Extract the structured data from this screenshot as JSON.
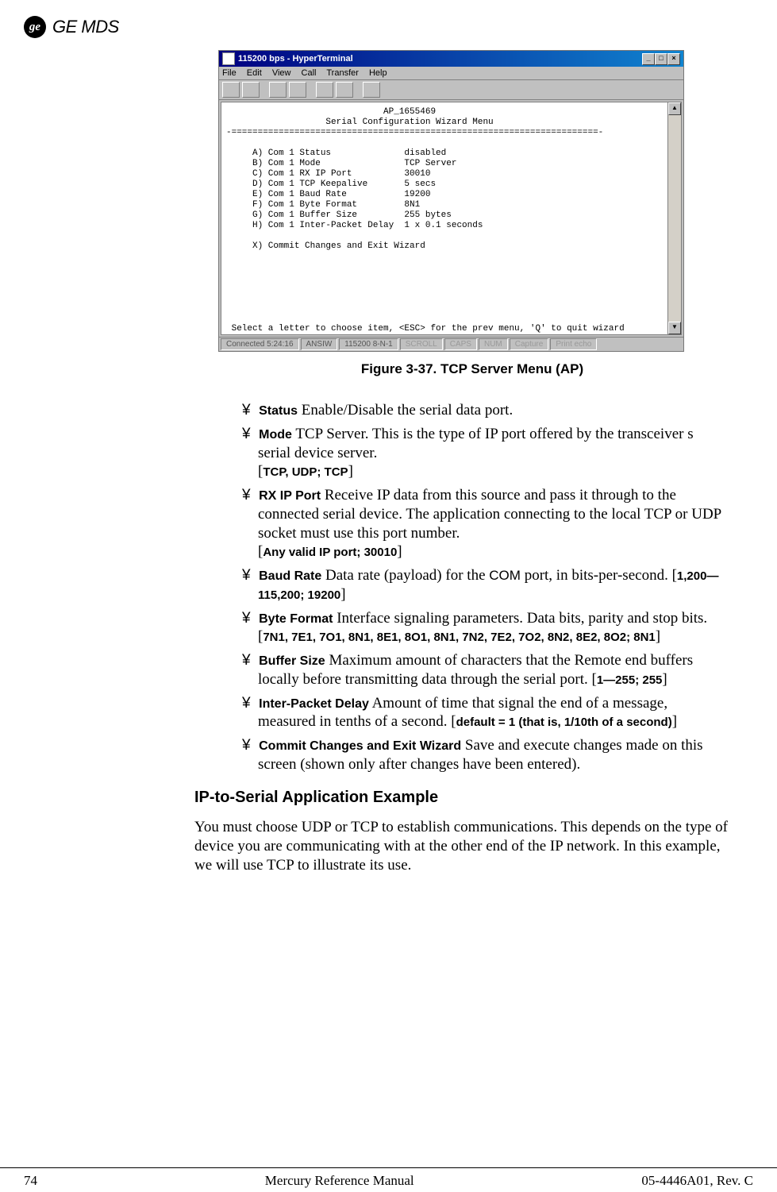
{
  "brand": {
    "logo_text": "ge",
    "name": "GE MDS"
  },
  "screenshot": {
    "title": "115200 bps - HyperTerminal",
    "menubar": [
      "File",
      "Edit",
      "View",
      "Call",
      "Transfer",
      "Help"
    ],
    "terminal_text": "                              AP_1655469\n                   Serial Configuration Wizard Menu\n-======================================================================-\n\n     A) Com 1 Status              disabled\n     B) Com 1 Mode                TCP Server\n     C) Com 1 RX IP Port          30010\n     D) Com 1 TCP Keepalive       5 secs\n     E) Com 1 Baud Rate           19200\n     F) Com 1 Byte Format         8N1\n     G) Com 1 Buffer Size         255 bytes\n     H) Com 1 Inter-Packet Delay  1 x 0.1 seconds\n\n     X) Commit Changes and Exit Wizard\n\n\n\n\n\n\n\n Select a letter to choose item, <ESC> for the prev menu, 'Q' to quit wizard",
    "status": {
      "connected": "Connected 5:24:16",
      "emulation": "ANSIW",
      "settings": "115200 8-N-1",
      "scroll": "SCROLL",
      "caps": "CAPS",
      "num": "NUM",
      "capture": "Capture",
      "echo": "Print echo"
    }
  },
  "figure_caption": "Figure 3-37. TCP Server Menu (AP)",
  "params": [
    {
      "name": "Status",
      "desc": "Enable/Disable the serial data port."
    },
    {
      "name": "Mode",
      "desc": "TCP Server. This is the type of IP port offered by the transceiver s serial device server.",
      "vals": "TCP, UDP; TCP"
    },
    {
      "name": "RX IP Port",
      "desc": "Receive IP data from this source and pass it through to the connected serial device. The application connecting to the local TCP or UDP socket must use this port number.",
      "vals": "Any valid IP port; 30010"
    },
    {
      "name": "Baud Rate",
      "desc_pre": "Data rate (payload) for the ",
      "desc_com": "COM",
      "desc_post": " port, in bits-per-second. ",
      "vals_inline": "1,200—115,200; 19200"
    },
    {
      "name": "Byte Format",
      "desc": "Interface signaling parameters. Data bits, parity and stop bits.",
      "vals": "7N1, 7E1, 7O1, 8N1, 8E1, 8O1, 8N1, 7N2, 7E2, 7O2, 8N2, 8E2, 8O2; 8N1"
    },
    {
      "name": "Buffer Size",
      "desc": "Maximum amount of characters that the Remote end buffers locally before transmitting data through the serial port. ",
      "vals_inline": "1—255; 255"
    },
    {
      "name": "Inter-Packet Delay",
      "desc": "Amount of time that signal the end of a message, measured in tenths of a second. ",
      "vals_inline": "default = 1 (that is, 1/10th of a second)"
    },
    {
      "name": "Commit Changes and Exit Wizard",
      "desc": "Save and execute changes made on this screen (shown only after changes have been entered)."
    }
  ],
  "section": {
    "heading": "IP-to-Serial Application Example",
    "body": "You must choose UDP or TCP to establish communications. This depends on the type of device you are communicating with at the other end of the IP network. In this example, we will use TCP to illustrate its use."
  },
  "footer": {
    "page": "74",
    "center": "Mercury Reference Manual",
    "right": "05-4446A01, Rev. C"
  }
}
